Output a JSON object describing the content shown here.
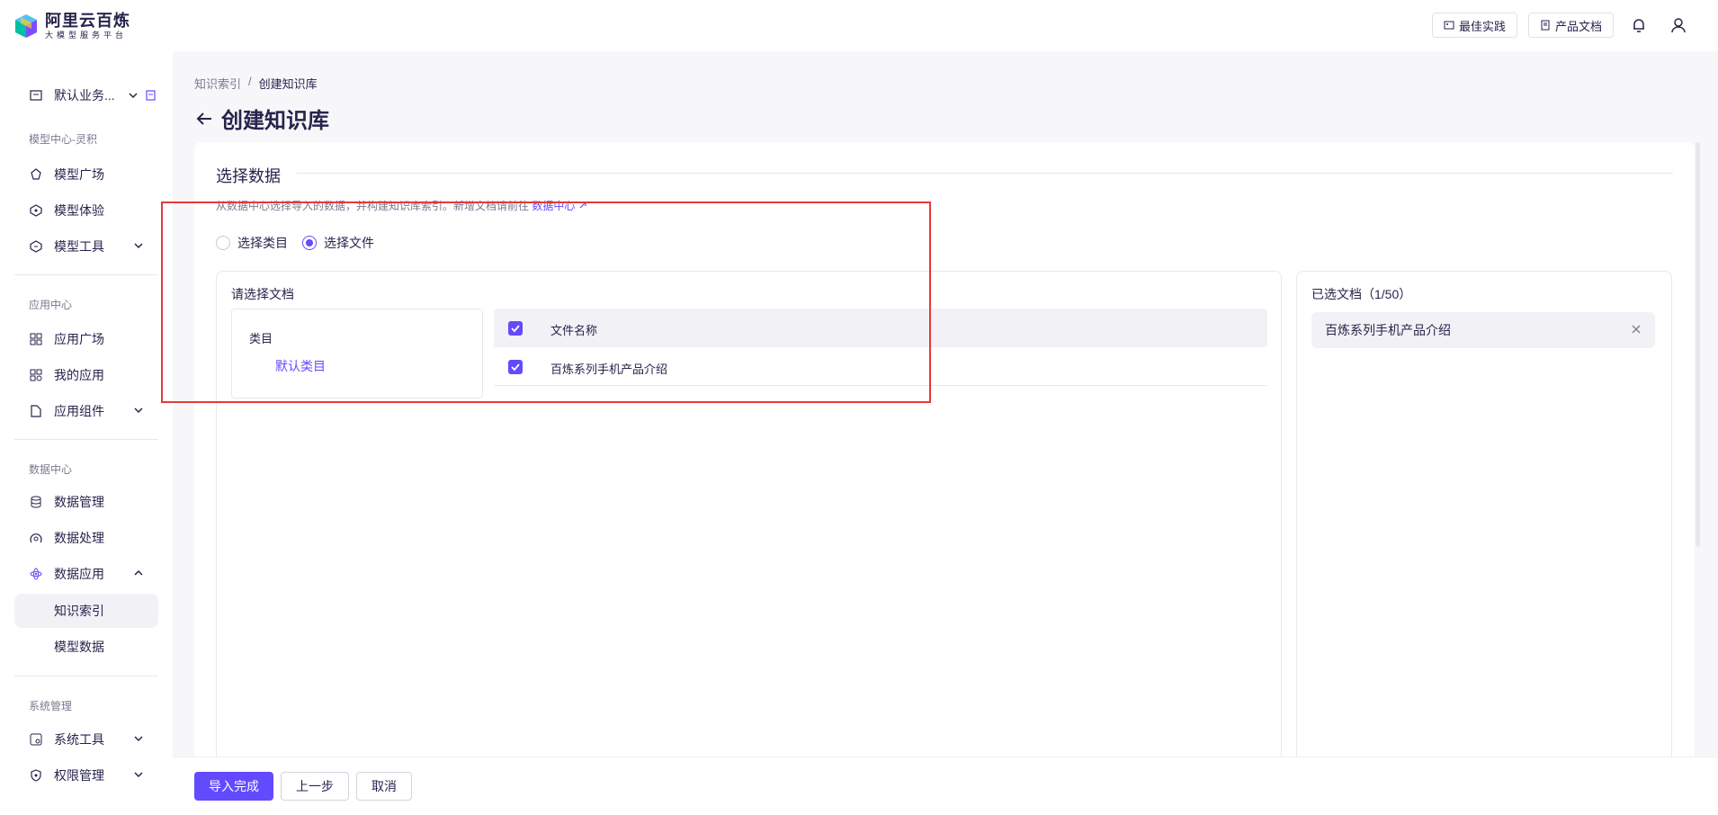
{
  "header": {
    "logo_title": "阿里云百炼",
    "logo_subtitle": "大模型服务平台",
    "best_practice": "最佳实践",
    "product_docs": "产品文档",
    "icons": [
      "bell-icon",
      "user-icon"
    ]
  },
  "sidebar": {
    "workspace": "默认业务...",
    "sections": [
      {
        "title": "模型中心-灵积",
        "items": [
          {
            "label": "模型广场",
            "icon": "model-square-icon"
          },
          {
            "label": "模型体验",
            "icon": "model-experience-icon"
          },
          {
            "label": "模型工具",
            "icon": "model-tools-icon",
            "expandable": true
          }
        ]
      },
      {
        "title": "应用中心",
        "items": [
          {
            "label": "应用广场",
            "icon": "app-square-icon"
          },
          {
            "label": "我的应用",
            "icon": "my-apps-icon"
          },
          {
            "label": "应用组件",
            "icon": "app-components-icon",
            "expandable": true
          }
        ]
      },
      {
        "title": "数据中心",
        "items": [
          {
            "label": "数据管理",
            "icon": "database-icon"
          },
          {
            "label": "数据处理",
            "icon": "data-process-icon"
          },
          {
            "label": "数据应用",
            "icon": "data-app-icon",
            "expanded": true
          },
          {
            "label": "知识索引",
            "sub": true,
            "active": true
          },
          {
            "label": "模型数据",
            "sub": true
          }
        ]
      },
      {
        "title": "系统管理",
        "items": [
          {
            "label": "系统工具",
            "icon": "system-tools-icon",
            "expandable": true
          },
          {
            "label": "权限管理",
            "icon": "permission-icon",
            "expandable": true
          }
        ]
      }
    ]
  },
  "breadcrumb": {
    "parent": "知识索引",
    "separator": "/",
    "current": "创建知识库"
  },
  "page_title": "创建知识库",
  "section": {
    "title": "选择数据",
    "hint_prefix": "从数据中心选择导入的数据，并构建知识库索引。新增文档请前往",
    "hint_link": "数据中心"
  },
  "radio": {
    "options": [
      "选择类目",
      "选择文件"
    ],
    "selected": "选择文件"
  },
  "doc_panel": {
    "title": "请选择文档",
    "category_label": "类目",
    "category_item": "默认类目",
    "table_header": "文件名称",
    "rows": [
      "百炼系列手机产品介绍"
    ]
  },
  "selected_panel": {
    "title": "已选文档（1/50）",
    "items": [
      "百炼系列手机产品介绍"
    ]
  },
  "footer": {
    "submit": "导入完成",
    "prev": "上一步",
    "cancel": "取消"
  },
  "colors": {
    "accent": "#624aff",
    "text": "#26244c",
    "highlight": "#e5393a"
  }
}
